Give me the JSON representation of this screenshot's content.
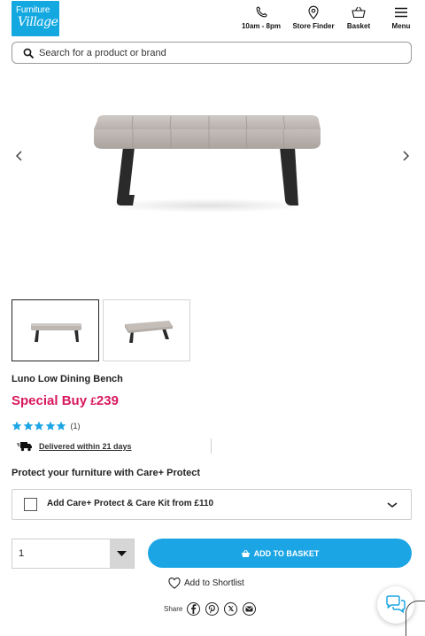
{
  "header": {
    "logo_line1": "Furniture",
    "logo_line2": "Village",
    "phone_label": "10am - 8pm",
    "store_label": "Store Finder",
    "basket_label": "Basket",
    "menu_label": "Menu"
  },
  "search": {
    "placeholder": "Search for a product or brand",
    "value": ""
  },
  "icons": {
    "phone": "phone-icon",
    "store": "map-pin-icon",
    "basket": "basket-icon",
    "menu": "hamburger-menu-icon",
    "search": "search-icon",
    "prev": "chevron-left-icon",
    "next": "chevron-right-icon",
    "delivery": "delivery-truck-icon",
    "chevron_down": "chevron-down-icon",
    "heart": "heart-icon",
    "chat": "chat-bubbles-icon"
  },
  "product": {
    "title": "Luno Low Dining Bench",
    "price_prefix": "Special Buy ",
    "price_currency": "£",
    "price_value": "239",
    "rating_stars": 5,
    "rating_count": "(1)",
    "delivery": "Delivered within 21 days"
  },
  "care": {
    "heading": "Protect your furniture with Care+ Protect",
    "option_label": "Add Care+ Protect & Care Kit from £110"
  },
  "purchase": {
    "quantity": "1",
    "add_to_basket": "ADD TO BASKET",
    "shortlist": "Add to Shortlist"
  },
  "share": {
    "label": "Share",
    "twitter_glyph": "𝕏"
  },
  "colors": {
    "brand_blue": "#14a8e1",
    "button_blue": "#1ba5e4",
    "price_pink": "#d8185e",
    "star_blue": "#1ba5e4"
  }
}
